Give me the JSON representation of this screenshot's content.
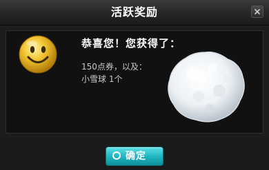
{
  "dialog": {
    "title": "活跃奖励",
    "close_icon": "close-icon"
  },
  "content": {
    "message": "恭喜您！您获得了：",
    "reward_line_1": "150点券，以及：",
    "reward_line_2": "小雪球 1个",
    "avatar_icon": "smiley-face-icon",
    "reward_image": "snowball"
  },
  "footer": {
    "ok_label": "确定",
    "ok_icon": "ring-icon"
  },
  "colors": {
    "accent": "#22b7c2",
    "background": "#1c1c1c",
    "smiley": "#f2c530"
  }
}
